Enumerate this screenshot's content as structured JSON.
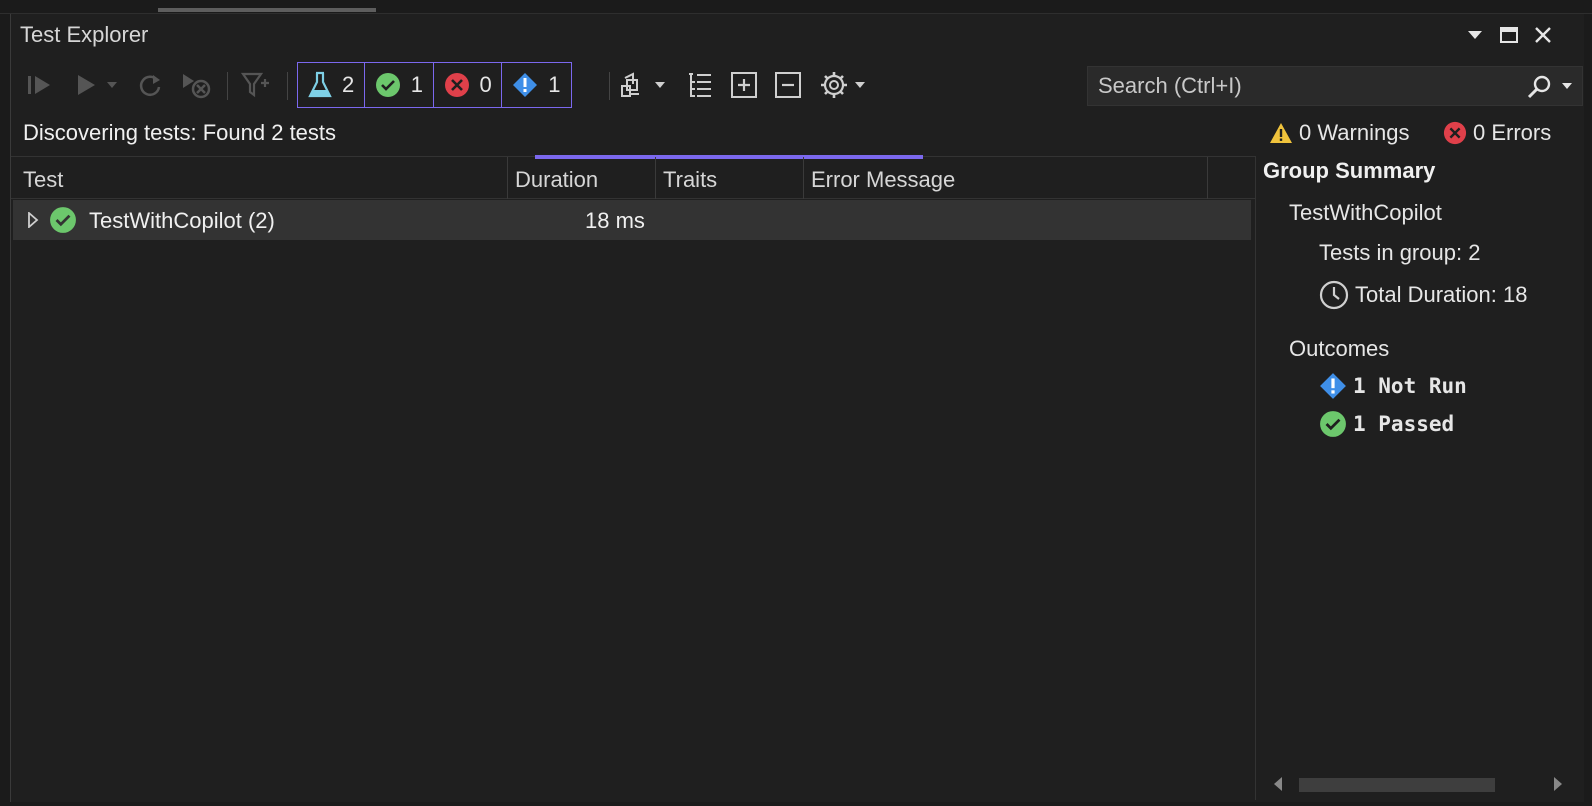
{
  "window": {
    "title": "Test Explorer"
  },
  "toolbar": {
    "filters": [
      {
        "name": "all",
        "count": "2",
        "icon": "flask-icon"
      },
      {
        "name": "passed",
        "count": "1",
        "icon": "passed-icon"
      },
      {
        "name": "failed",
        "count": "0",
        "icon": "failed-icon"
      },
      {
        "name": "not-run",
        "count": "1",
        "icon": "not-run-icon"
      }
    ],
    "search_placeholder": "Search (Ctrl+I)"
  },
  "status": {
    "message": "Discovering tests: Found 2 tests",
    "warnings": "0 Warnings",
    "errors": "0 Errors"
  },
  "grid": {
    "columns": [
      "Test",
      "Duration",
      "Traits",
      "Error Message"
    ],
    "rows": [
      {
        "name": "TestWithCopilot (2)",
        "duration": "18 ms",
        "traits": "",
        "error": "",
        "outcome": "passed"
      }
    ]
  },
  "summary": {
    "title": "Group Summary",
    "group_name": "TestWithCopilot",
    "tests_in_group": "Tests in group: 2",
    "total_duration": "Total Duration: 18",
    "outcomes_label": "Outcomes",
    "not_run": "1 Not Run",
    "passed": "1 Passed"
  },
  "colors": {
    "accent": "#7b68ee",
    "passed": "#6cc76c",
    "failed": "#e0404a",
    "not_run": "#3f8fe8",
    "warning": "#f0c33c"
  }
}
